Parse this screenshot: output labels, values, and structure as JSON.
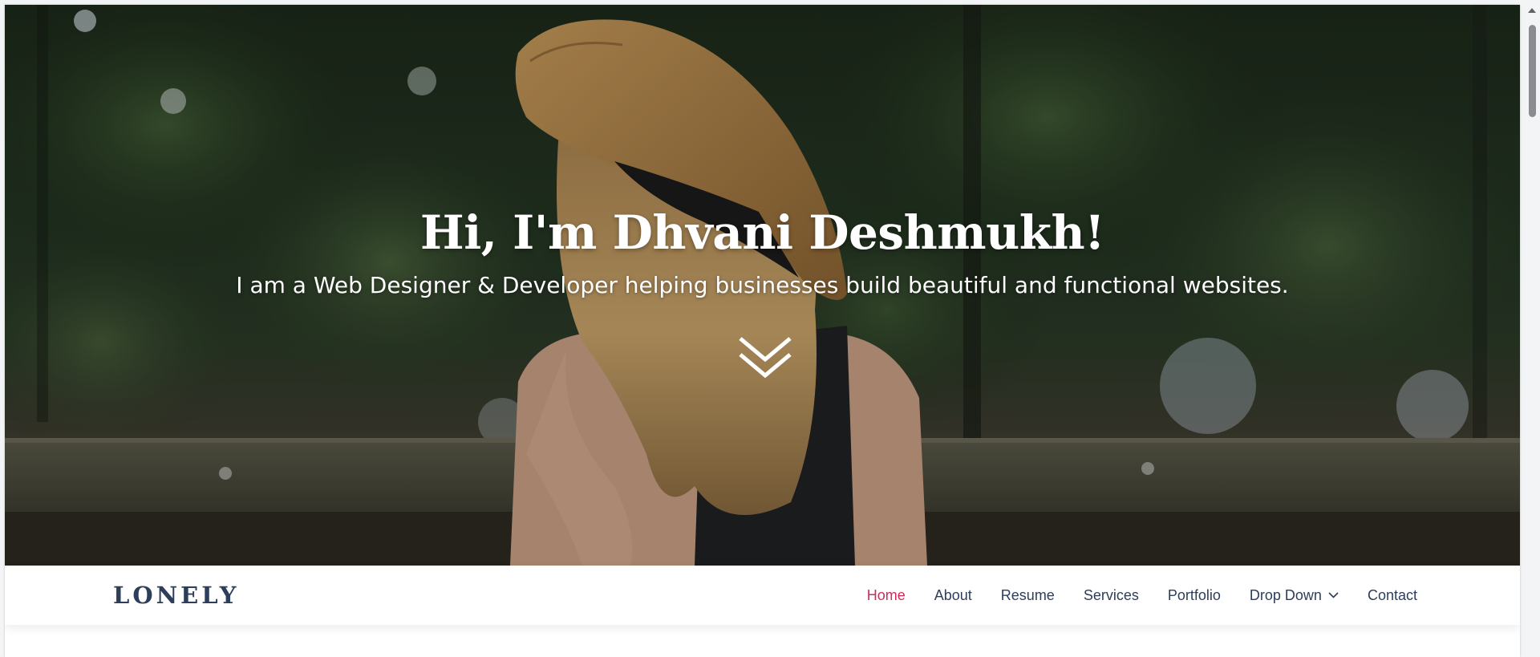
{
  "hero": {
    "title": "Hi, I'm Dhvani Deshmukh!",
    "subtitle": "I am a Web Designer & Developer helping businesses build beautiful and functional websites.",
    "scroll_icon": "double-chevron-down-icon",
    "background": "photo of a woman in a straw hat sitting on a wooden bench among green foliage"
  },
  "navbar": {
    "logo": "LONELY",
    "items": [
      {
        "label": "Home",
        "active": true
      },
      {
        "label": "About",
        "active": false
      },
      {
        "label": "Resume",
        "active": false
      },
      {
        "label": "Services",
        "active": false
      },
      {
        "label": "Portfolio",
        "active": false
      },
      {
        "label": "Drop Down",
        "active": false,
        "icon": "chevron-down-icon"
      },
      {
        "label": "Contact",
        "active": false
      }
    ]
  },
  "colors": {
    "accent": "#d32a5c",
    "nav_text": "#2c3e5a",
    "hero_text": "#ffffff"
  }
}
